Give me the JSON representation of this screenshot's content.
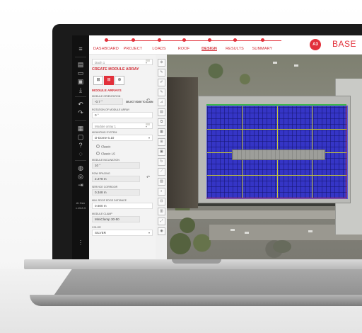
{
  "app": {
    "brand": "BASE",
    "brand_logo_text": "A3"
  },
  "nav": {
    "steps": [
      {
        "label": "DASHBOARD",
        "active": false
      },
      {
        "label": "PROJECT",
        "active": false
      },
      {
        "label": "LOADS",
        "active": false
      },
      {
        "label": "ROOF",
        "active": false
      },
      {
        "label": "DESIGN",
        "active": true
      },
      {
        "label": "RESULTS",
        "active": false
      },
      {
        "label": "SUMMARY",
        "active": false
      }
    ],
    "accent": "#e2313b"
  },
  "rail": {
    "info_line1": "AI Gen",
    "info_line2": "v.15.8.3"
  },
  "panel": {
    "roof_select": "Dach 1",
    "create_title": "CREATE MODULE ARRAY",
    "section_title": "MODULE ARRAYS",
    "orientation_label": "MODULE ORIENTATION",
    "orientation_value": "-0.7 °",
    "align_label": "SELECT EDGE TO ALIGN",
    "rotation_label": "ROTATION OF MODULE ARRAY",
    "rotation_value": "0 °",
    "array_select": "Module array 1",
    "mounting_label": "MOUNTING SYSTEM",
    "mounting_value": "D-Dome 6.10",
    "options": [
      "Classic",
      "Classic LS"
    ],
    "inclination_label": "MODULE INCLINATION",
    "inclination_value": "10 °",
    "row_spacing_label": "ROW SPACING",
    "row_spacing_value": "2.278 m",
    "service_corridor_label": "SERVICE CORRIDOR",
    "service_corridor_value": "0.348 m",
    "roof_edge_label": "MIN. ROOF EDGE DISTANCE",
    "roof_edge_value": "0.600 m",
    "clamp_label": "MODULE CLAMP",
    "clamp_value": "MiniClamp 30-50",
    "color_label": "COLOR",
    "color_value": "SILVER"
  },
  "map": {
    "array_color": "#3535c6",
    "array_columns": 4,
    "array_rows": 4
  }
}
